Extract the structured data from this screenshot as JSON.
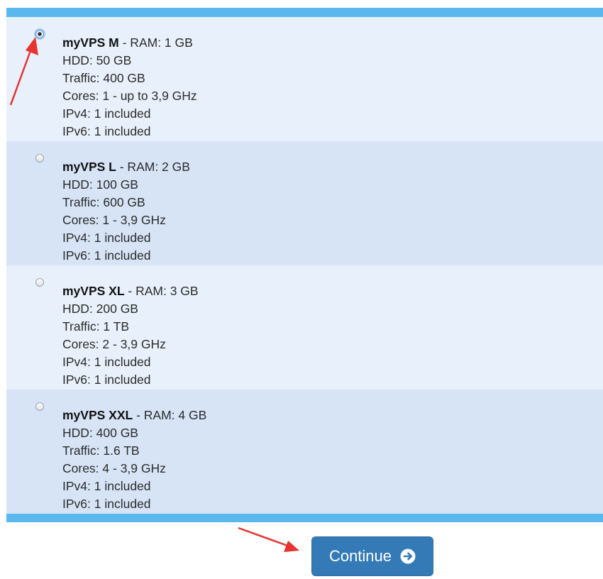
{
  "plans": [
    {
      "name": "myVPS M",
      "ram": " - RAM: 1 GB",
      "hdd": "HDD: 50 GB",
      "traffic": "Traffic: 400 GB",
      "cores": "Cores: 1 - up to 3,9 GHz",
      "ipv4": "IPv4: 1 included",
      "ipv6": "IPv6: 1 included",
      "selected": true
    },
    {
      "name": "myVPS L",
      "ram": " - RAM: 2 GB",
      "hdd": "HDD: 100 GB",
      "traffic": "Traffic: 600 GB",
      "cores": "Cores: 1 - 3,9 GHz",
      "ipv4": "IPv4: 1 included",
      "ipv6": "IPv6: 1 included",
      "selected": false
    },
    {
      "name": "myVPS XL",
      "ram": " - RAM: 3 GB",
      "hdd": "HDD: 200 GB",
      "traffic": "Traffic: 1 TB",
      "cores": "Cores: 2 - 3,9 GHz",
      "ipv4": "IPv4: 1 included",
      "ipv6": "IPv6: 1 included",
      "selected": false
    },
    {
      "name": "myVPS XXL",
      "ram": " - RAM: 4 GB",
      "hdd": "HDD: 400 GB",
      "traffic": "Traffic: 1.6 TB",
      "cores": "Cores: 4 - 3,9 GHz",
      "ipv4": "IPv4: 1 included",
      "ipv6": "IPv6: 1 included",
      "selected": false
    }
  ],
  "continue_button": {
    "label": "Continue",
    "icon": "arrow-circle-right-icon"
  },
  "annotations": {
    "arrow_color": "#e8332e"
  },
  "colors": {
    "panel_border": "#5bb8ef",
    "row_light": "#e8f1fb",
    "row_dark": "#d6e4f6",
    "button": "#337ab7"
  }
}
